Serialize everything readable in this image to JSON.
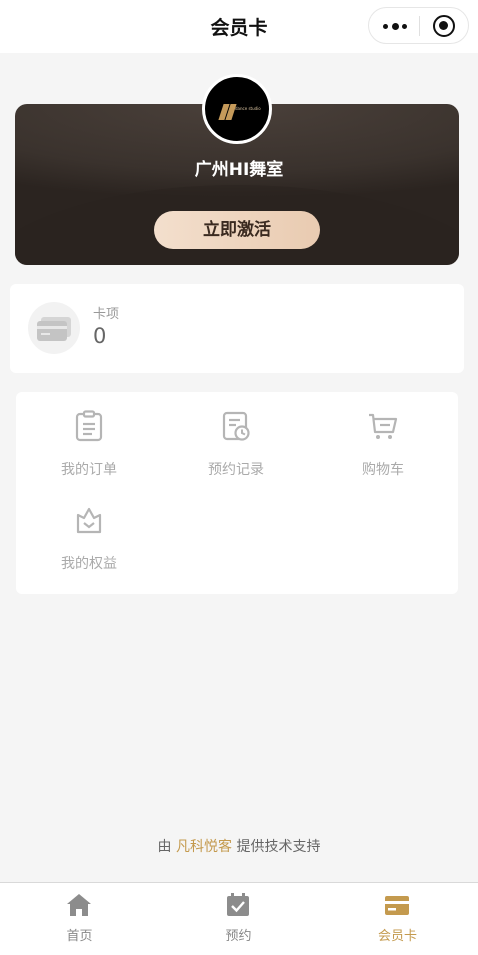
{
  "navbar": {
    "title": "会员卡"
  },
  "member_card": {
    "studio_name": "广州HI舞室",
    "activate_label": "立即激活",
    "logo_text": "dance studio"
  },
  "card_summary": {
    "label": "卡项",
    "count": "0"
  },
  "menu": [
    {
      "label": "我的订单",
      "icon": "clipboard-icon"
    },
    {
      "label": "预约记录",
      "icon": "appointment-record-icon"
    },
    {
      "label": "购物车",
      "icon": "cart-icon"
    },
    {
      "label": "我的权益",
      "icon": "crown-icon"
    }
  ],
  "footer": {
    "prefix": "由 ",
    "brand": "凡科悦客",
    "suffix": " 提供技术支持"
  },
  "tabbar": [
    {
      "label": "首页",
      "icon": "home-icon",
      "active": false
    },
    {
      "label": "预约",
      "icon": "calendar-check-icon",
      "active": false
    },
    {
      "label": "会员卡",
      "icon": "member-card-icon",
      "active": true
    }
  ],
  "colors": {
    "accent": "#c49a4e",
    "card_dark": "#3a322d",
    "button_peach": "#f0d8c3"
  }
}
